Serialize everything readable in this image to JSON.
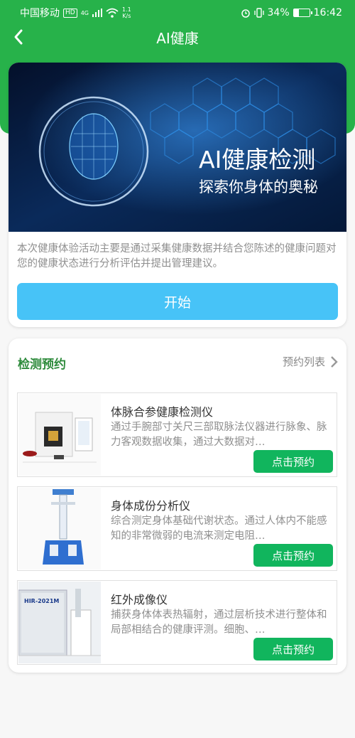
{
  "status_bar": {
    "carrier": "中国移动",
    "hd": "HD",
    "net": "4G",
    "speed_top": "1.1",
    "speed_unit": "K/s",
    "battery_pct": "34%",
    "battery_level": 0.34,
    "time": "16:42"
  },
  "nav": {
    "title": "AI健康"
  },
  "banner": {
    "headline": "AI健康检测",
    "subline": "探索你身体的奥秘",
    "description": "本次健康体验活动主要是通过采集健康数据并结合您陈述的健康问题对您的健康状态进行分析评估并提出管理建议。",
    "start_label": "开始"
  },
  "booking": {
    "title": "检测预约",
    "list_link": "预约列表",
    "devices": [
      {
        "name": "体脉合参健康检测仪",
        "desc": "通过手腕部寸关尺三部取脉法仪器进行脉象、脉力客观数据收集，通过大数据对…",
        "button": "点击预约"
      },
      {
        "name": "身体成份分析仪",
        "desc": "综合测定身体基础代谢状态。通过人体内不能感知的非常微弱的电流来测定电阻…",
        "button": "点击预约"
      },
      {
        "name": "红外成像仪",
        "desc": "捕获身体体表热辐射，通过层析技术进行整体和局部相结合的健康评测。细胞、…",
        "button": "点击预约",
        "img_label": "HIR-2021M"
      }
    ]
  },
  "colors": {
    "header_green": "#27b24a",
    "start_button": "#47c3f7",
    "book_button": "#11b55d",
    "section_title": "#2e8b3c"
  }
}
